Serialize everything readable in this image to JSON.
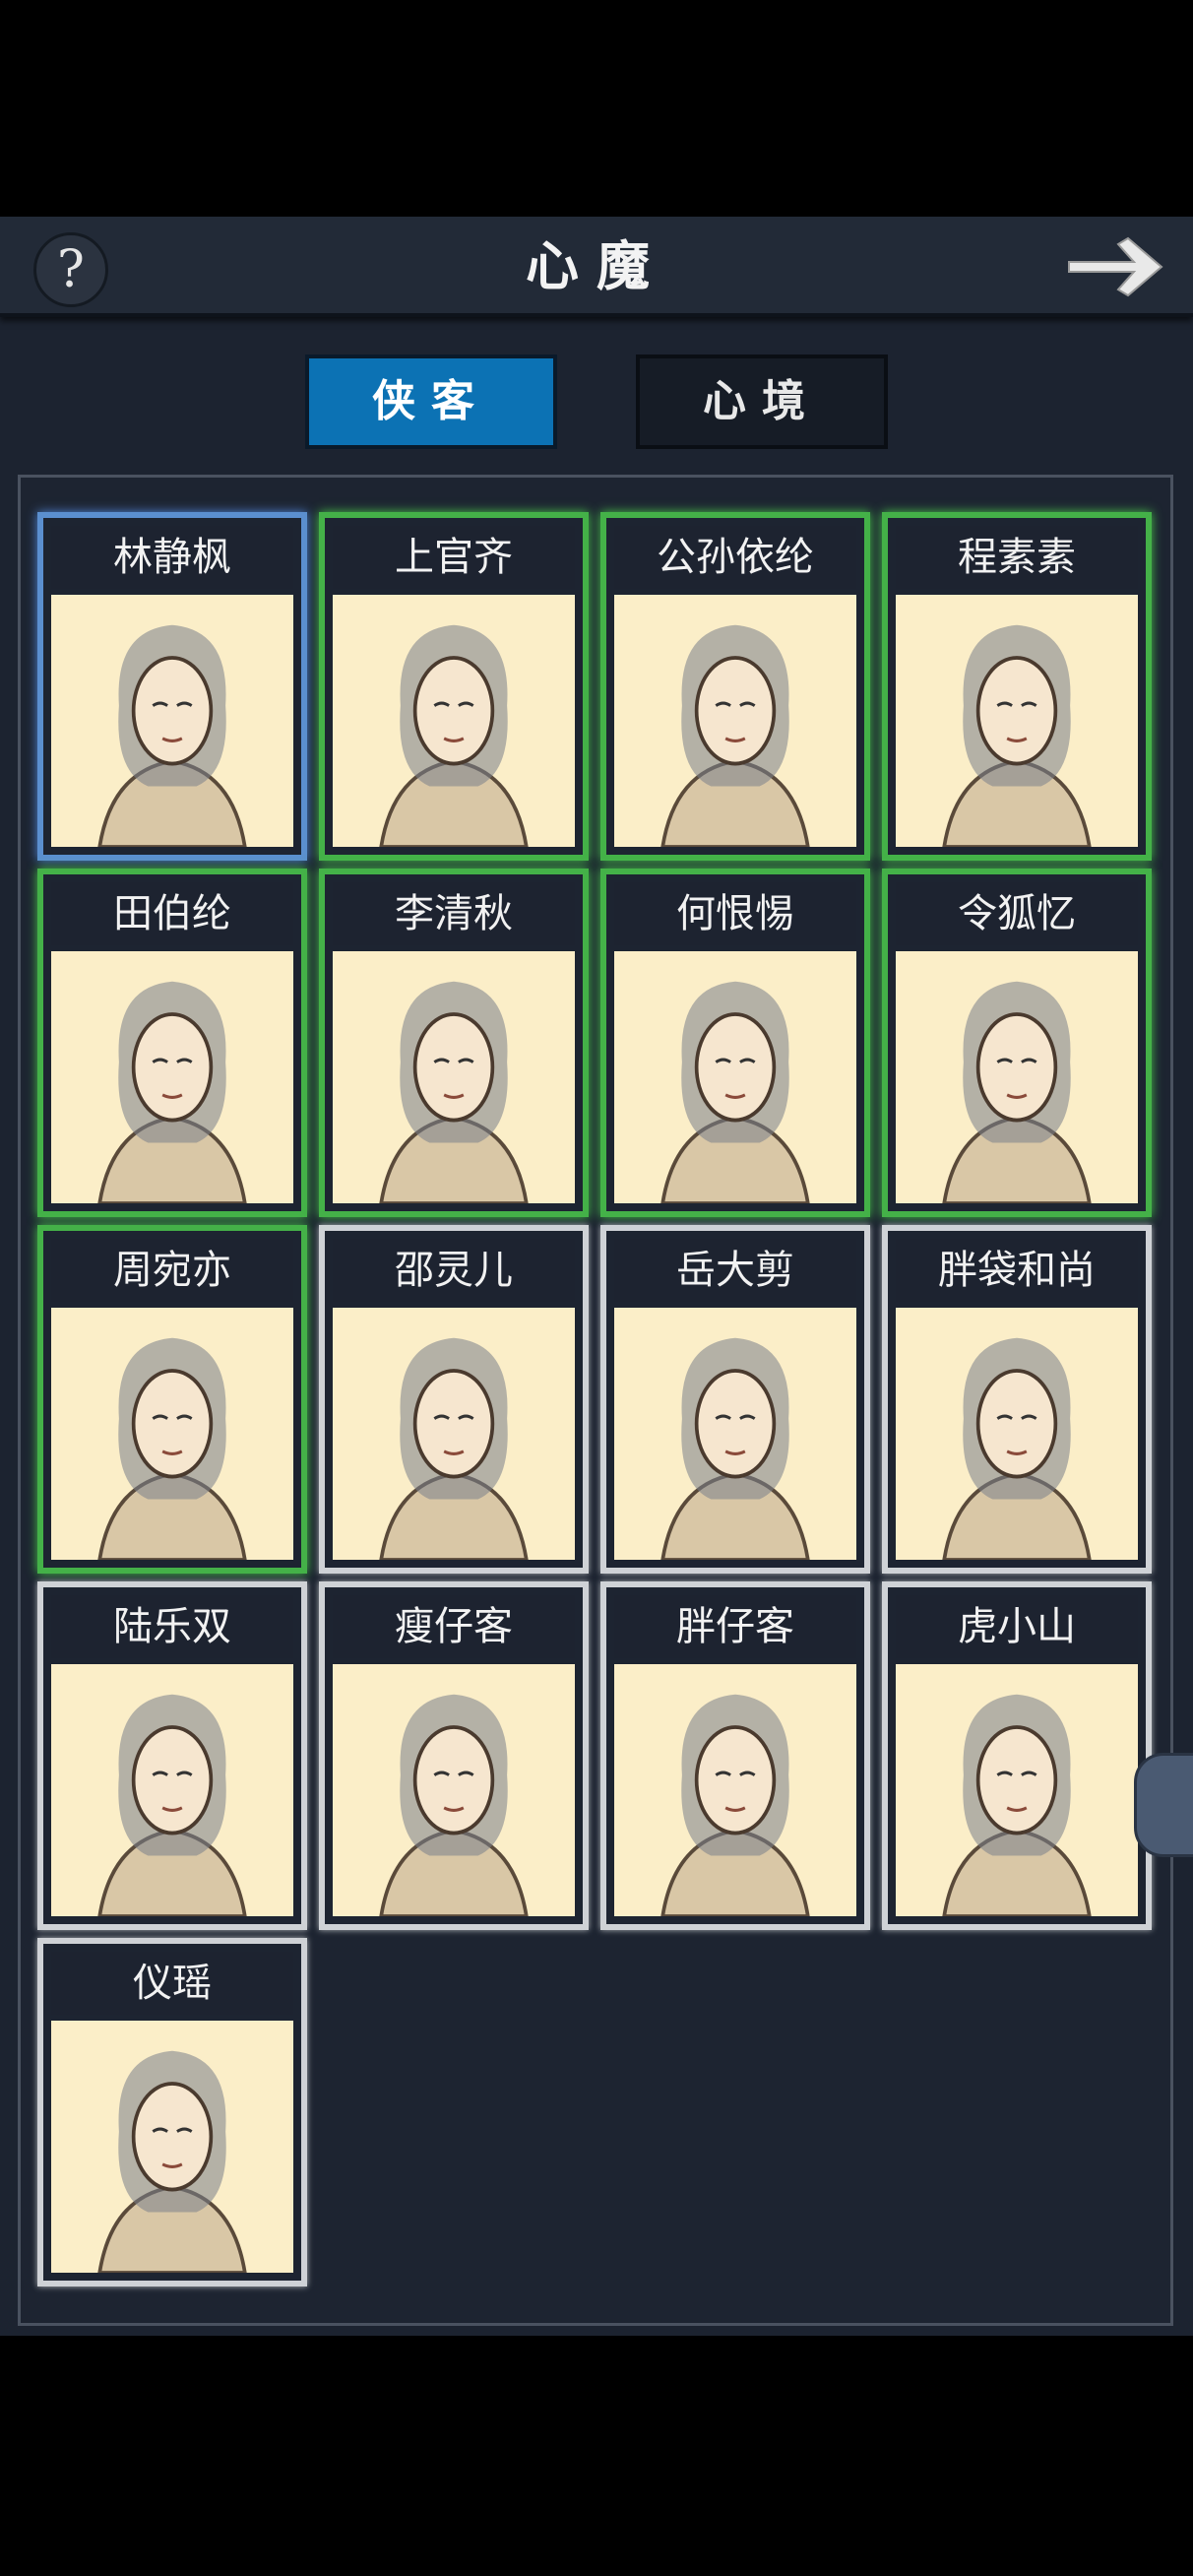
{
  "header": {
    "title": "心魔",
    "help_icon": "question-mark-icon",
    "back_icon": "arrow-right-icon"
  },
  "tabs": [
    {
      "label": "侠客",
      "active": true
    },
    {
      "label": "心境",
      "active": false
    }
  ],
  "colors": {
    "accent_blue": "#0c72b4",
    "frame_blue": "#5b8fcf",
    "frame_green": "#44b148",
    "frame_gray": "#cfd2d6",
    "portrait_bg": "#fbeec8"
  },
  "characters": [
    {
      "name": "林静枫",
      "frame": "blue"
    },
    {
      "name": "上官齐",
      "frame": "green"
    },
    {
      "name": "公孙依纶",
      "frame": "green"
    },
    {
      "name": "程素素",
      "frame": "green"
    },
    {
      "name": "田伯纶",
      "frame": "green"
    },
    {
      "name": "李清秋",
      "frame": "green"
    },
    {
      "name": "何恨惕",
      "frame": "green"
    },
    {
      "name": "令狐忆",
      "frame": "green"
    },
    {
      "name": "周宛亦",
      "frame": "green"
    },
    {
      "name": "邵灵儿",
      "frame": "gray"
    },
    {
      "name": "岳大剪",
      "frame": "gray"
    },
    {
      "name": "胖袋和尚",
      "frame": "gray"
    },
    {
      "name": "陆乐双",
      "frame": "gray"
    },
    {
      "name": "瘦仔客",
      "frame": "gray"
    },
    {
      "name": "胖仔客",
      "frame": "gray"
    },
    {
      "name": "虎小山",
      "frame": "gray"
    },
    {
      "name": "仪瑶",
      "frame": "gray"
    }
  ]
}
